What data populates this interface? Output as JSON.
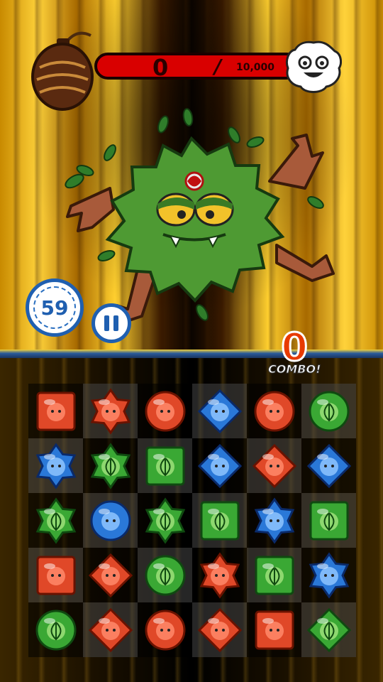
{
  "hud": {
    "hp_current": "0",
    "hp_separator": "/",
    "hp_max": "10,000",
    "timer": "59",
    "combo_count": "0",
    "combo_label": "COMBO!"
  },
  "colors": {
    "fire": "#d83a22",
    "water": "#2166c7",
    "wood": "#2f9a2a",
    "hp_bar": "#d90000"
  },
  "board": {
    "rows": [
      [
        "fire-square",
        "fire-star",
        "fire-circle",
        "water-diamond",
        "fire-circle",
        "wood-circle"
      ],
      [
        "water-star",
        "wood-star",
        "wood-square",
        "water-diamond",
        "fire-diamond",
        "water-diamond"
      ],
      [
        "wood-star",
        "water-circle",
        "wood-star",
        "wood-square",
        "water-star",
        "wood-square"
      ],
      [
        "fire-square",
        "fire-diamond",
        "wood-circle",
        "fire-star",
        "wood-square",
        "water-star"
      ],
      [
        "wood-circle",
        "fire-diamond",
        "fire-circle",
        "fire-diamond",
        "fire-square",
        "wood-diamond"
      ]
    ]
  }
}
